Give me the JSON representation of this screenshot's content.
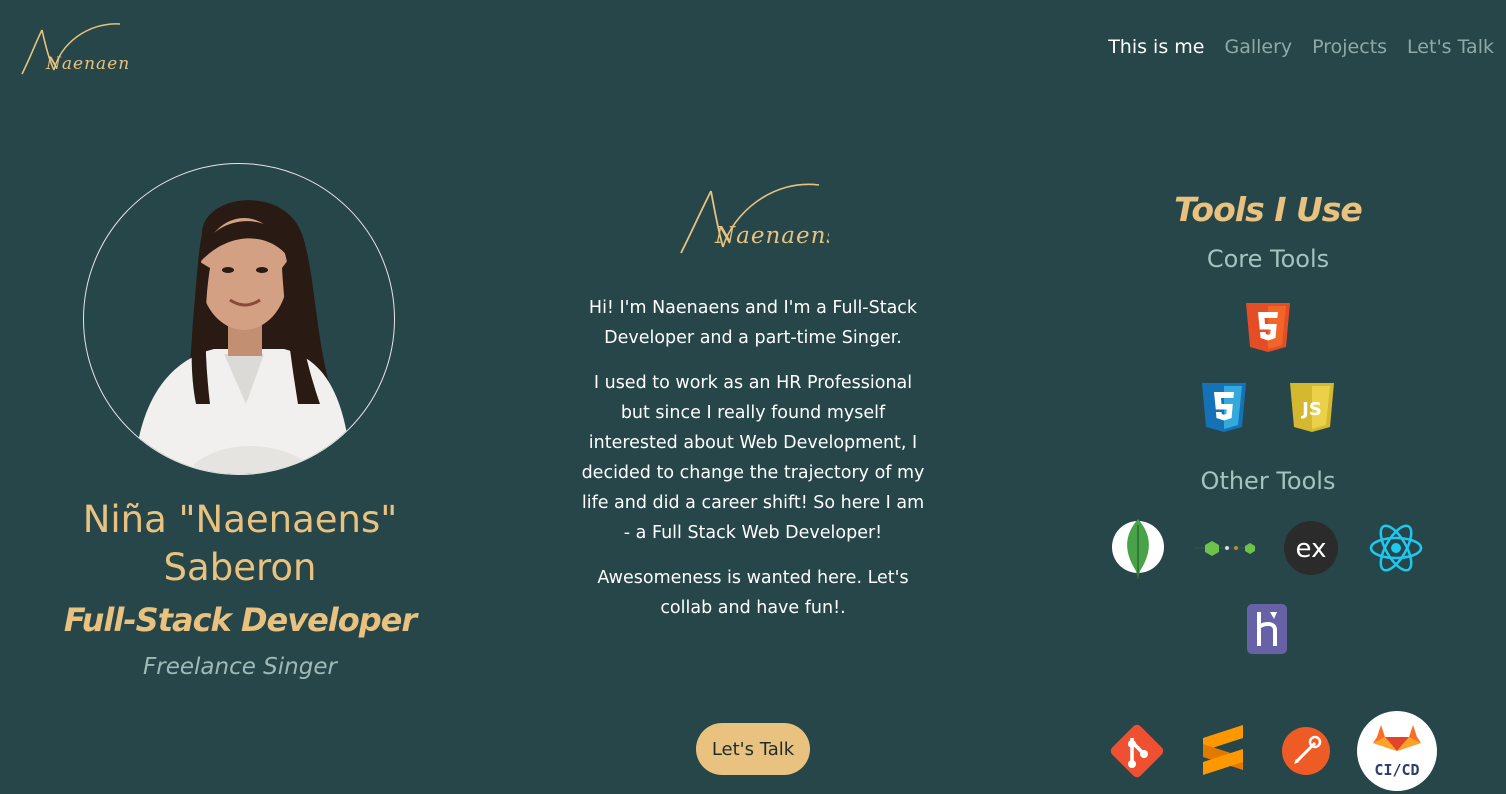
{
  "brand": {
    "logo_text": "Naenaens"
  },
  "nav": {
    "items": [
      {
        "label": "This is me",
        "active": true
      },
      {
        "label": "Gallery",
        "active": false
      },
      {
        "label": "Projects",
        "active": false
      },
      {
        "label": "Let's Talk",
        "active": false
      }
    ]
  },
  "profile": {
    "name_line1": "Niña \"Naenaens\"",
    "name_line2": "Saberon",
    "title": "Full-Stack Developer",
    "subtitle": "Freelance Singer"
  },
  "about": {
    "logo_text": "Naenaens",
    "paragraph1": "Hi! I'm Naenaens and I'm a Full-Stack Developer and a part-time Singer.",
    "paragraph2": "I used to work as an HR Professional but since I really found myself interested about Web Development, I decided to change the trajectory of my life and did a career shift! So here I am - a Full Stack Web Developer!",
    "paragraph3": "Awesomeness is wanted here. Let's collab and have fun!.",
    "cta_label": "Let's Talk"
  },
  "tools": {
    "title": "Tools I Use",
    "core_heading": "Core Tools",
    "other_heading": "Other Tools",
    "core_icons": [
      "html5-icon",
      "css3-icon",
      "javascript-icon"
    ],
    "other_icons": [
      "mongodb-icon",
      "nodejs-icon",
      "express-icon",
      "react-icon",
      "heroku-icon",
      "git-icon",
      "sublime-icon",
      "postman-icon",
      "gitlab-ci-cd-icon"
    ],
    "js_label": "JS",
    "express_label": "ex",
    "cicd_label": "CI/CD"
  },
  "colors": {
    "background": "#27464a",
    "accent": "#e8c27e",
    "muted": "#9fb9b6",
    "nav_inactive": "#8fa9a7"
  }
}
